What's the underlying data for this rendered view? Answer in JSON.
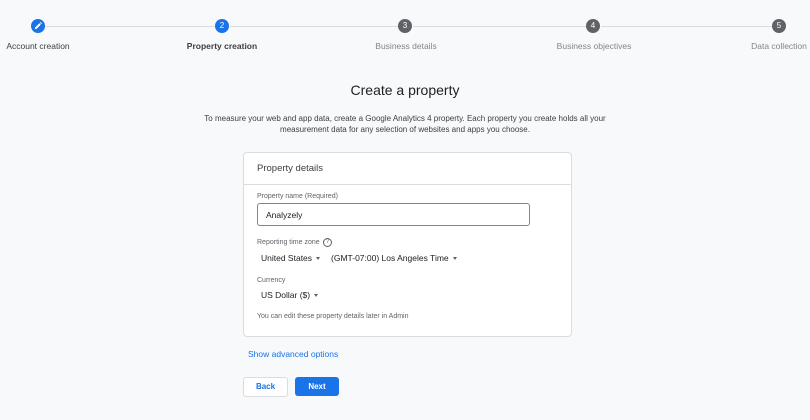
{
  "stepper": {
    "steps": [
      {
        "label": "Account creation",
        "number": "",
        "status": "done"
      },
      {
        "label": "Property creation",
        "number": "2",
        "status": "current"
      },
      {
        "label": "Business details",
        "number": "3",
        "status": "upcoming"
      },
      {
        "label": "Business objectives",
        "number": "4",
        "status": "upcoming"
      },
      {
        "label": "Data collection",
        "number": "5",
        "status": "upcoming"
      }
    ],
    "done_icon": "pencil-icon"
  },
  "page": {
    "title": "Create a property",
    "subtitle_line1": "To measure your web and app data, create a Google Analytics 4 property. Each property you create holds all your",
    "subtitle_line2": "measurement data for any selection of websites and apps you choose."
  },
  "card": {
    "title": "Property details",
    "property_name_label": "Property name (Required)",
    "property_name_value": "Analyzely",
    "timezone_label": "Reporting time zone",
    "help_icon": "help-icon",
    "country": "United States",
    "timezone": "(GMT-07:00) Los Angeles Time",
    "currency_label": "Currency",
    "currency": "US Dollar ($)",
    "note": "You can edit these property details later in Admin"
  },
  "actions": {
    "advanced_link": "Show advanced options",
    "back_label": "Back",
    "next_label": "Next"
  },
  "colors": {
    "accent": "#1a73e8",
    "step_inactive": "#5f6368",
    "background": "#f8f9fa"
  }
}
